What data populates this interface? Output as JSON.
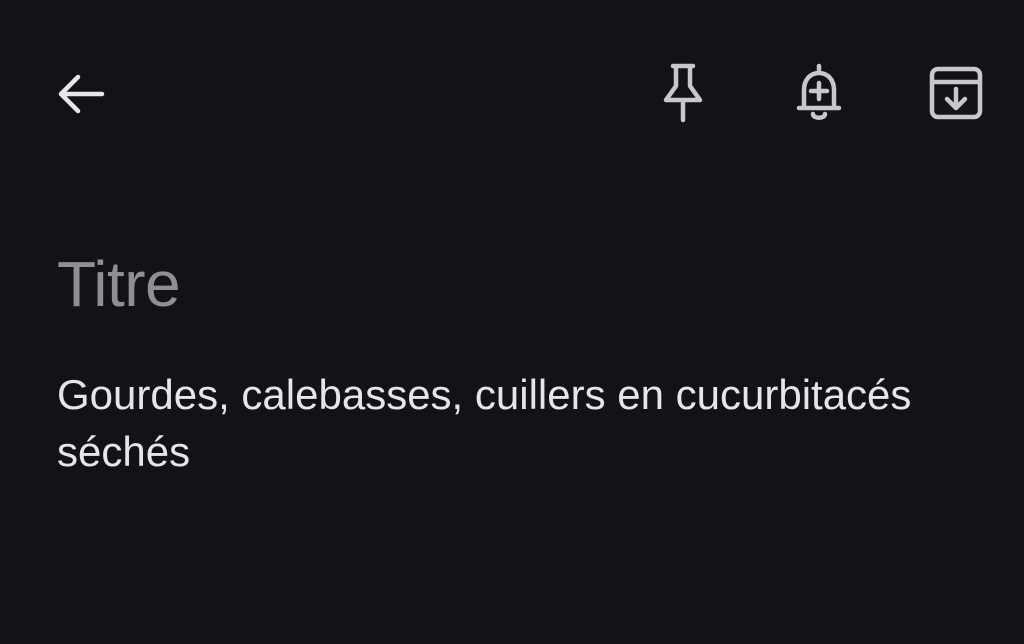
{
  "toolbar": {
    "back_icon": "arrow-left-icon",
    "pin_icon": "pin-icon",
    "reminder_icon": "bell-plus-icon",
    "archive_icon": "archive-icon"
  },
  "note": {
    "title_placeholder": "Titre",
    "body_text": "Gourdes, calebasses, cuillers en cucurbitacés séchés"
  },
  "colors": {
    "background": "#131317",
    "icon": "#c8c8cc",
    "placeholder": "#8e8f93",
    "text": "#e6e6e9"
  }
}
